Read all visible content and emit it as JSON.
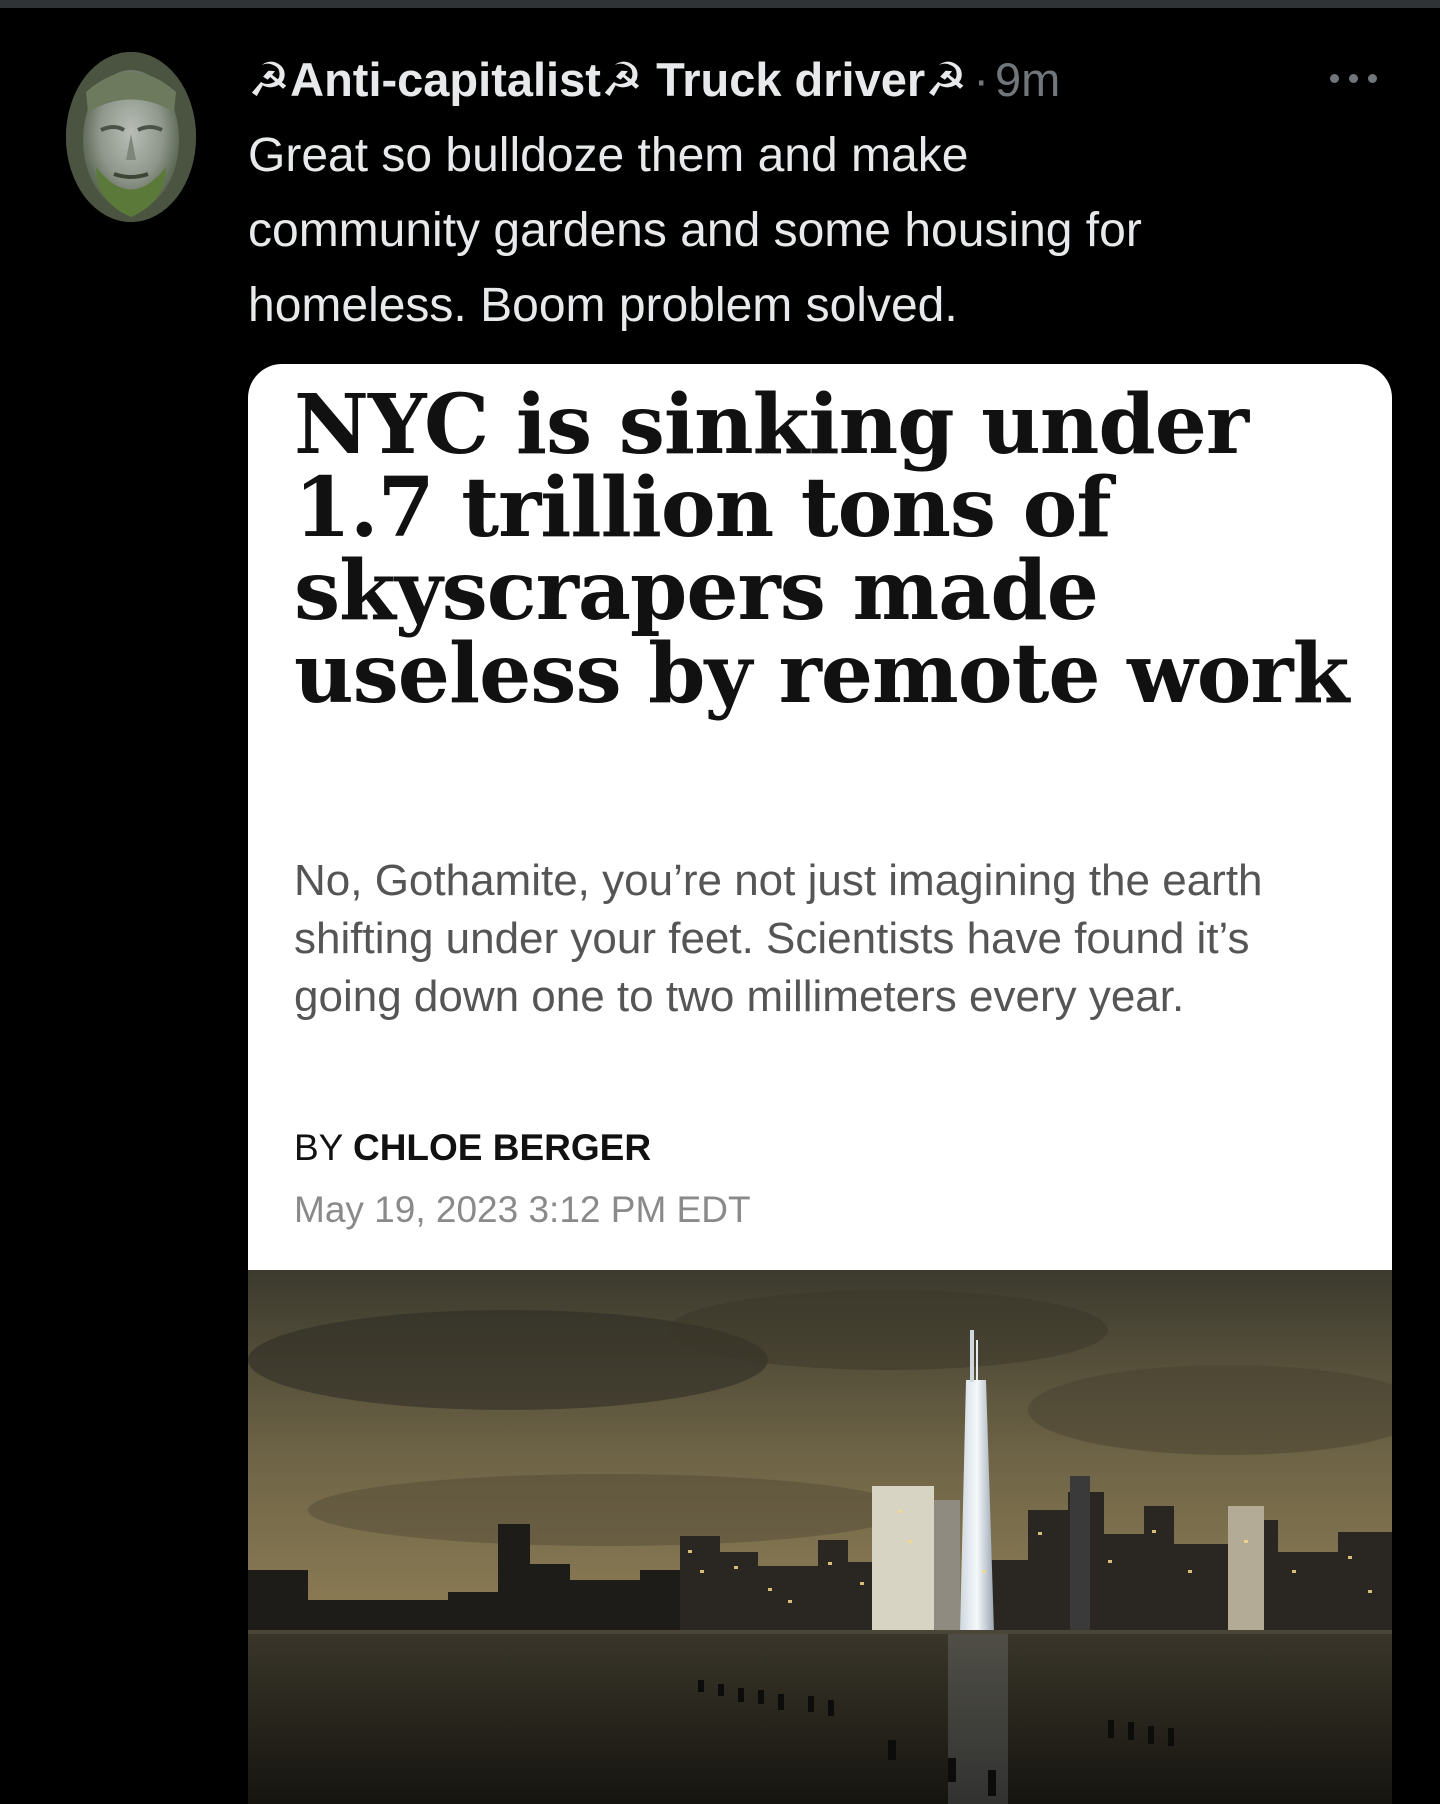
{
  "tweet": {
    "display_name": "☭Anti-capitalist☭ Truck driver☭",
    "separator": "·",
    "time": "9m",
    "text": "Great so bulldoze them and make\ncommunity gardens and some housing for\nhomeless. Boom problem solved."
  },
  "card": {
    "headline": "NYC is sinking under 1.7 trillion tons of skyscrapers made useless by remote work",
    "dek": "No, Gothamite, you’re not just imagining the earth shifting under your feet. Scientists have found it’s going down one to two millimeters every year.",
    "byline_prefix": "BY",
    "author": "CHLOE BERGER",
    "date": "May 19, 2023 3:12 PM EDT"
  },
  "icons": {
    "more": "more-horizontal-icon",
    "avatar": "stone-statue-face-avatar"
  },
  "colors": {
    "background": "#000000",
    "text_primary": "#e7e9ea",
    "text_secondary": "#71767b",
    "card_background": "#ffffff",
    "headline": "#111111",
    "dek": "#555555",
    "date": "#8a8a8a"
  }
}
